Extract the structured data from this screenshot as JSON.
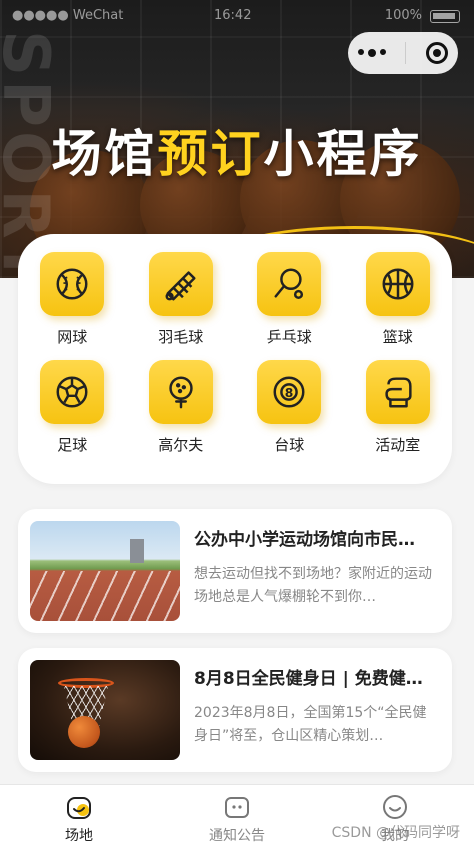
{
  "status_bar": {
    "carrier": "●●●●● WeChat",
    "time": "16:42",
    "battery": "100%"
  },
  "hero": {
    "title_part1": "场馆",
    "title_part2": "预订",
    "title_part3": "小程序",
    "deco_text": "SPORTS"
  },
  "categories": [
    {
      "label": "网球",
      "icon": "tennis-ball-icon"
    },
    {
      "label": "羽毛球",
      "icon": "shuttlecock-icon"
    },
    {
      "label": "乒乓球",
      "icon": "ping-pong-icon"
    },
    {
      "label": "篮球",
      "icon": "basketball-icon"
    },
    {
      "label": "足球",
      "icon": "football-icon"
    },
    {
      "label": "高尔夫",
      "icon": "golf-icon"
    },
    {
      "label": "台球",
      "icon": "billiards-icon"
    },
    {
      "label": "活动室",
      "icon": "boxing-glove-icon"
    }
  ],
  "news": [
    {
      "title": "公办中小学运动场馆向市民…",
      "desc": "想去运动但找不到场地？家附近的运动场地总是人气爆棚轮不到你…"
    },
    {
      "title": "8月8日全民健身日 | 免费健…",
      "desc": "2023年8月8日，全国第15个“全民健身日”将至，仓山区精心策划…"
    }
  ],
  "tabbar": [
    {
      "label": "场地",
      "icon": "venue-icon",
      "active": true
    },
    {
      "label": "通知公告",
      "icon": "notice-icon",
      "active": false
    },
    {
      "label": "我的",
      "icon": "profile-icon",
      "active": false
    }
  ],
  "watermark": "CSDN @代码同学呀",
  "colors": {
    "accent": "#ffd21f",
    "icon_bg": "#f6c311"
  }
}
